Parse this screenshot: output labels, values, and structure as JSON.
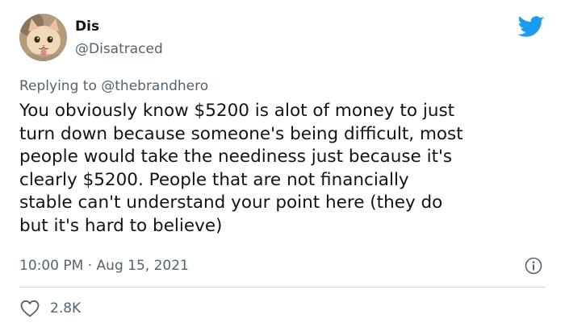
{
  "author": {
    "display_name": "Dis",
    "handle": "@Disatraced"
  },
  "reply": {
    "prefix": "Replying to",
    "mention": "@thebrandhero"
  },
  "body_lines": [
    "You obviously know $5200 is alot of money to just",
    "turn down because someone's being difficult, most",
    "people would take the neediness just because it's",
    "clearly $5200. People that are not financially",
    "stable can't understand your point here (they do",
    "but it's hard to believe)"
  ],
  "meta": {
    "time": "10:00 PM",
    "separator": "·",
    "date": "Aug 15, 2021"
  },
  "stats": {
    "likes": "2.8K"
  },
  "icons": {
    "brand": "twitter-bird-icon",
    "info": "info-icon",
    "like": "heart-icon"
  },
  "colors": {
    "brand_blue": "#1d9bf0",
    "muted_text": "#536471",
    "main_text": "#0f1419",
    "divider": "#cfd9de"
  }
}
